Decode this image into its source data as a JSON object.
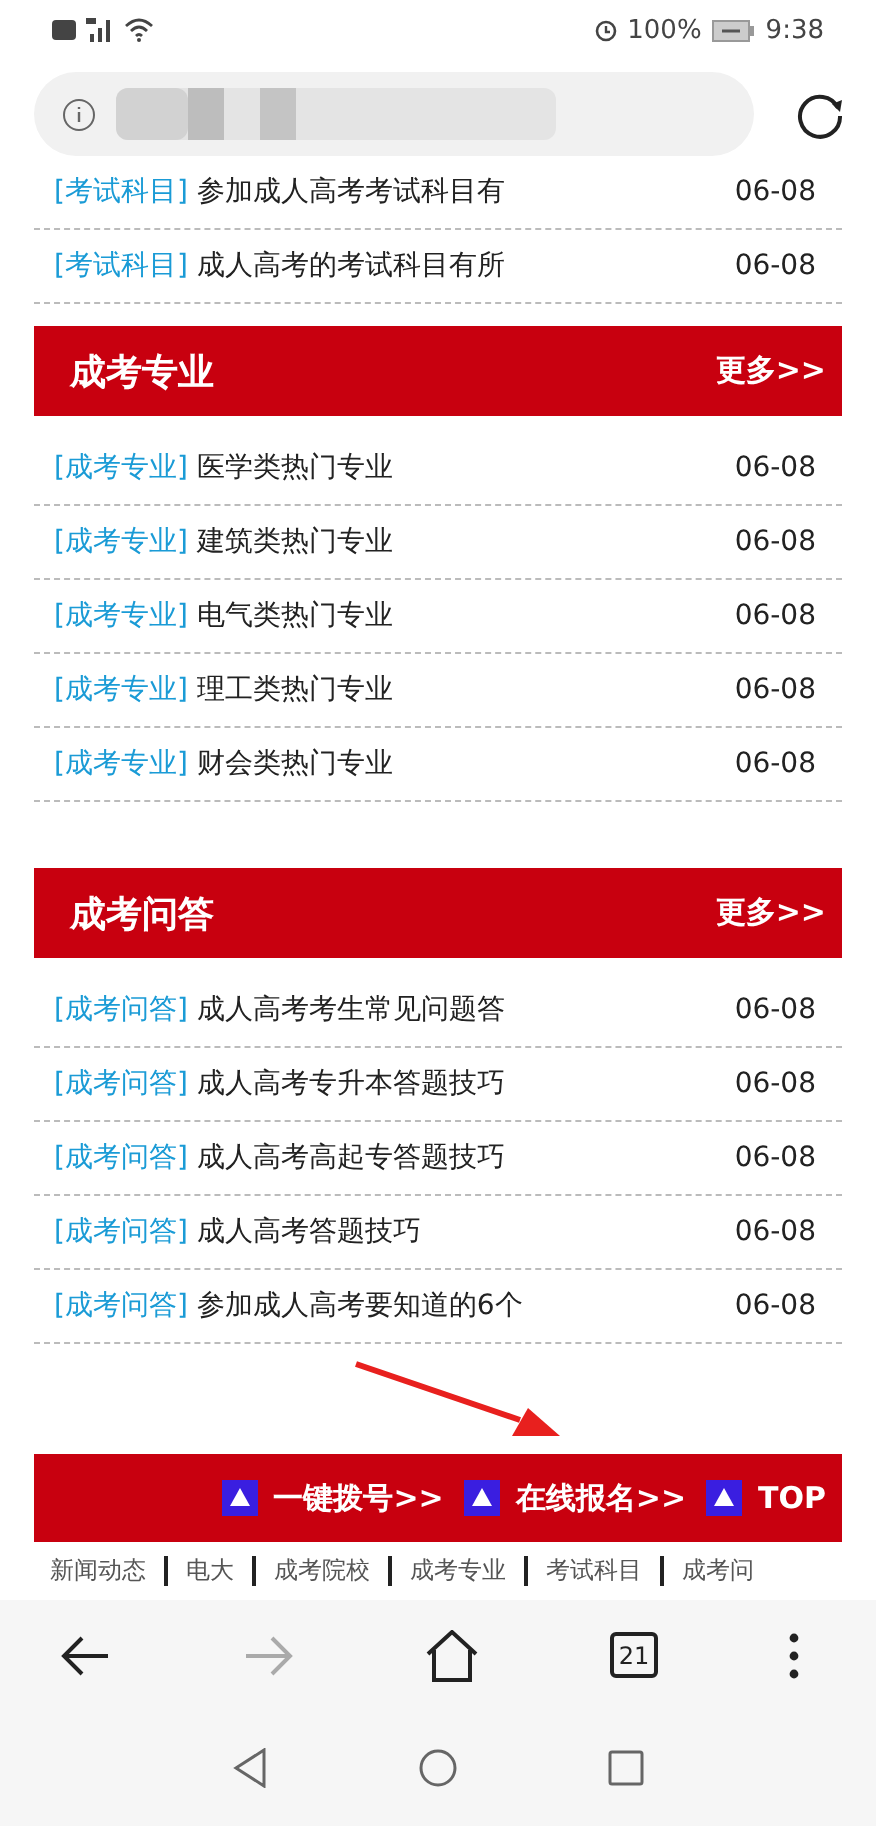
{
  "status_bar": {
    "battery": "100%",
    "time": "9:38"
  },
  "top_rows": [
    {
      "tag": "[考试科目]",
      "title": "参加成人高考考试科目有",
      "date": "06-08"
    },
    {
      "tag": "[考试科目]",
      "title": "成人高考的考试科目有所",
      "date": "06-08"
    }
  ],
  "sections": [
    {
      "title": "成考专业",
      "more": "更多>>",
      "rows": [
        {
          "tag": "[成考专业]",
          "title": "医学类热门专业",
          "date": "06-08"
        },
        {
          "tag": "[成考专业]",
          "title": "建筑类热门专业",
          "date": "06-08"
        },
        {
          "tag": "[成考专业]",
          "title": "电气类热门专业",
          "date": "06-08"
        },
        {
          "tag": "[成考专业]",
          "title": "理工类热门专业",
          "date": "06-08"
        },
        {
          "tag": "[成考专业]",
          "title": "财会类热门专业",
          "date": "06-08"
        }
      ]
    },
    {
      "title": "成考问答",
      "more": "更多>>",
      "rows": [
        {
          "tag": "[成考问答]",
          "title": "成人高考考生常见问题答",
          "date": "06-08"
        },
        {
          "tag": "[成考问答]",
          "title": "成人高考专升本答题技巧",
          "date": "06-08"
        },
        {
          "tag": "[成考问答]",
          "title": "成人高考高起专答题技巧",
          "date": "06-08"
        },
        {
          "tag": "[成考问答]",
          "title": "成人高考答题技巧",
          "date": "06-08"
        },
        {
          "tag": "[成考问答]",
          "title": "参加成人高考要知道的6个",
          "date": "06-08"
        }
      ]
    }
  ],
  "footer_bar": {
    "buttons": [
      {
        "label": "一键拨号>>"
      },
      {
        "label": "在线报名>>"
      },
      {
        "label": "TOP"
      }
    ]
  },
  "nav_links": [
    "新闻动态",
    "电大",
    "成考院校",
    "成考专业",
    "考试科目",
    "成考问"
  ],
  "browser_toolbar": {
    "tab_count": "21",
    "forward_disabled": true
  }
}
